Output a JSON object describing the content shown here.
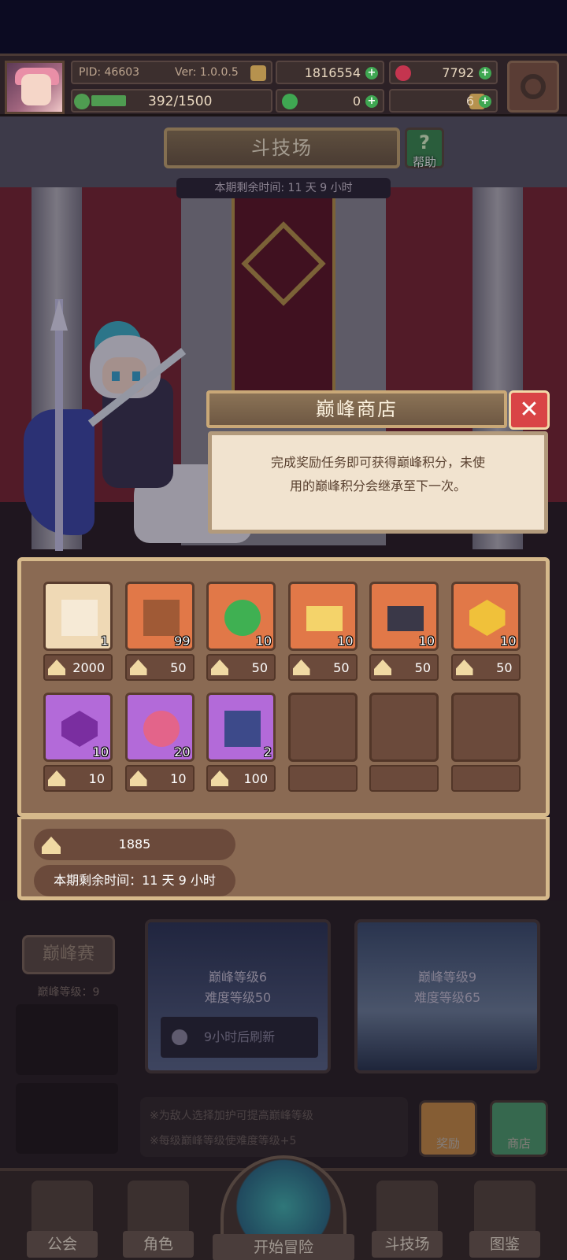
{
  "header": {
    "pid": "PID: 46603",
    "version": "Ver: 1.0.0.5",
    "gold": "1816554",
    "gems": "7792",
    "stamina": "392/1500",
    "clover": "0",
    "keys": "6"
  },
  "arena": {
    "title": "斗技场",
    "help_label": "帮助",
    "help_glyph": "?",
    "remaining": "本期剩余时间: 11 天 9 小时"
  },
  "shop": {
    "title": "巅峰商店",
    "close_glyph": "✕",
    "description_line1": "完成奖励任务即可获得巅峰积分，未使",
    "description_line2": "用的巅峰积分会继承至下一次。",
    "items": [
      {
        "icon": "scroll-icon",
        "qty": "1",
        "price": "2000",
        "color": "cream"
      },
      {
        "icon": "treasure-chest-icon",
        "qty": "99",
        "price": "50",
        "color": "orange"
      },
      {
        "icon": "clover-icon",
        "qty": "10",
        "price": "50",
        "color": "orange"
      },
      {
        "icon": "letter-gold-icon",
        "qty": "10",
        "price": "50",
        "color": "orange"
      },
      {
        "icon": "letter-dark-icon",
        "qty": "10",
        "price": "50",
        "color": "orange"
      },
      {
        "icon": "gold-gem-icon",
        "qty": "10",
        "price": "50",
        "color": "orange"
      },
      {
        "icon": "purple-gem-icon",
        "qty": "10",
        "price": "10",
        "color": "purple"
      },
      {
        "icon": "berry-icon",
        "qty": "20",
        "price": "10",
        "color": "purple"
      },
      {
        "icon": "book-icon",
        "qty": "2",
        "price": "100",
        "color": "purple"
      }
    ],
    "points": "1885",
    "remaining": "本期剩余时间：11 天 9 小时"
  },
  "lower": {
    "peak_button": "巅峰赛",
    "peak_level": "巅峰等级：9",
    "card1_line1": "巅峰等级6",
    "card1_line2": "难度等级50",
    "card1_refresh": "9小时后刷新",
    "card2_line1": "巅峰等级9",
    "card2_line2": "难度等级65",
    "tip1": "※为敌人选择加护可提高巅峰等级",
    "tip2": "※每级巅峰等级使难度等级+5",
    "reward_label": "奖励",
    "shop_label": "商店"
  },
  "nav": {
    "guild": "公会",
    "character": "角色",
    "adventure": "开始冒险",
    "arena": "斗技场",
    "codex": "图鉴"
  },
  "colors": {
    "cream": "#efd9b5",
    "orange": "#e17848",
    "purple": "#b36ad9",
    "panel": "#8a6a53",
    "close": "#d94446"
  }
}
